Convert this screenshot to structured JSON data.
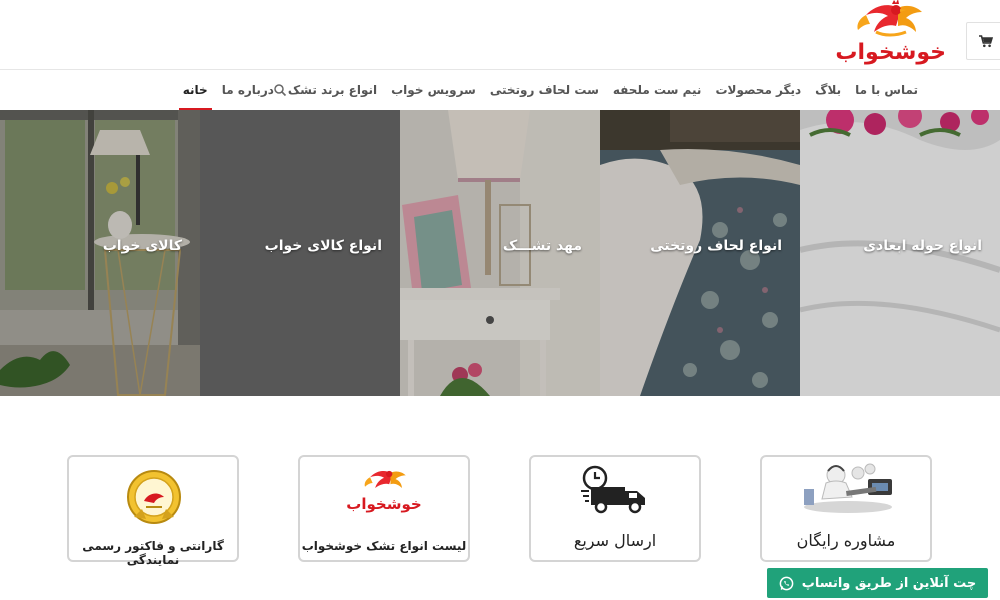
{
  "header": {
    "logo_text": "خوشخواب",
    "cart_icon": "cart-icon"
  },
  "nav": {
    "items": [
      {
        "label": "خانه",
        "active": true
      },
      {
        "label": "درباره ما"
      },
      {
        "label": "انواع برند تشک"
      },
      {
        "label": "سرویس خواب"
      },
      {
        "label": "ست لحاف روتختی"
      },
      {
        "label": "نیم ست ملحفه"
      },
      {
        "label": "دیگر محصولات"
      },
      {
        "label": "بلاگ"
      },
      {
        "label": "تماس با ما"
      }
    ],
    "search_icon": "search-icon"
  },
  "banner": {
    "panels": [
      {
        "label": "کالای خواب"
      },
      {
        "label": "انواع کالای خواب"
      },
      {
        "label": "مهد تشـــک"
      },
      {
        "label": "انواع لحاف روتختی"
      },
      {
        "label": "انواع حوله ابعادی"
      }
    ]
  },
  "features": {
    "guarantee": {
      "label": "گارانتی و فاکتور رسمی نمایندگی"
    },
    "list": {
      "label": "لیست انواع تشک خوشخواب",
      "logo_text": "خوشخواب"
    },
    "shipping": {
      "label": "ارسال سریع"
    },
    "consult": {
      "label": "مشاوره رایگان"
    }
  },
  "whatsapp": {
    "label": "چت آنلاین از طریق واتساپ",
    "icon": "whatsapp-icon"
  },
  "colors": {
    "brand_red": "#d71920",
    "whatsapp_green": "#20a27a"
  }
}
